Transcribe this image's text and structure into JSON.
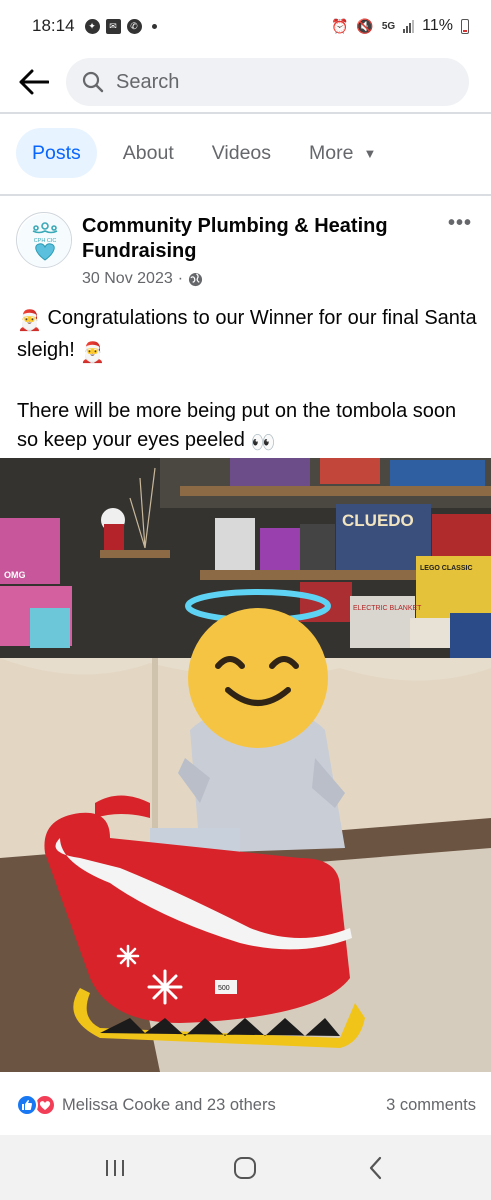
{
  "status_bar": {
    "time": "18:14",
    "network": "5G",
    "battery": "11%"
  },
  "search": {
    "placeholder": "Search"
  },
  "tabs": [
    {
      "label": "Posts",
      "active": true
    },
    {
      "label": "About"
    },
    {
      "label": "Videos"
    },
    {
      "label": "More"
    }
  ],
  "post": {
    "author": "Community Plumbing & Heating Fundraising",
    "avatar_text": "CPH CIC",
    "date": "30 Nov 2023",
    "separator": "·",
    "paragraph1": "Congratulations to our Winner for our final Santa sleigh!",
    "paragraph2": "There will be more being put on the tombola soon so keep your eyes peeled",
    "emojis": {
      "santa": "🎅",
      "eyes": "👀"
    },
    "photo_texts": {
      "cluedo": "CLUEDO",
      "lego_classic": "LEGO CLASSIC",
      "electric_blanket": "ELECTRIC BLANKET",
      "omg": "OMG",
      "price_tag": "500"
    },
    "reactions": {
      "people": "Melissa Cooke and 23 others",
      "comments": "3 comments"
    }
  },
  "colors": {
    "accent": "#0866ff",
    "like": "#1877f2",
    "love": "#f33e58",
    "sleigh_red": "#d8232a"
  }
}
